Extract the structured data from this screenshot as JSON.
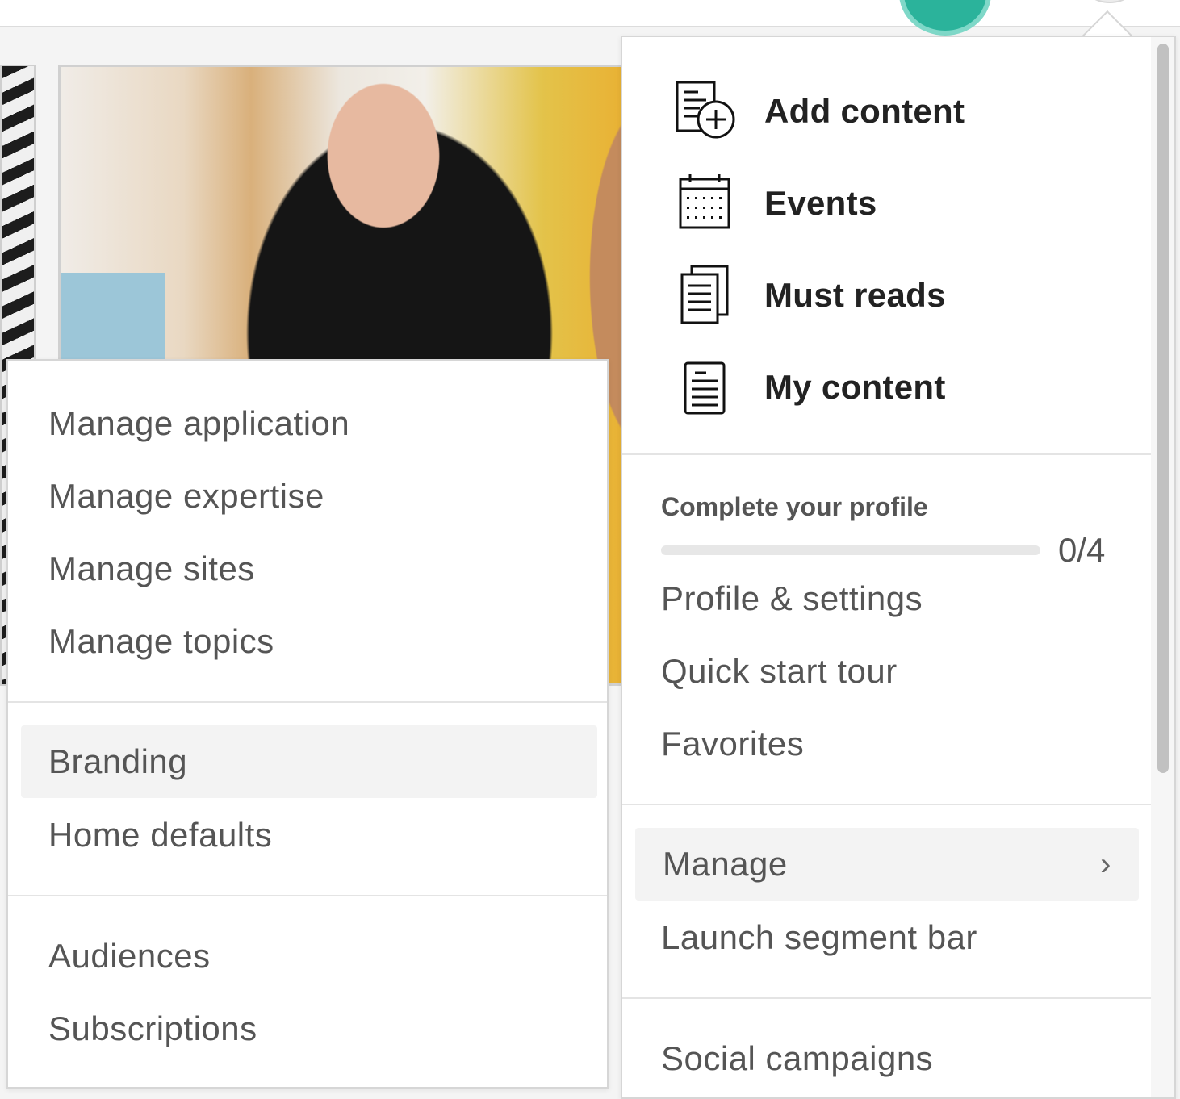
{
  "quick_actions": [
    {
      "label": "Add content",
      "icon": "add-document-icon"
    },
    {
      "label": "Events",
      "icon": "calendar-icon"
    },
    {
      "label": "Must reads",
      "icon": "stacked-documents-icon"
    },
    {
      "label": "My content",
      "icon": "document-icon"
    }
  ],
  "profile": {
    "title": "Complete your profile",
    "progress_text": "0/4",
    "progress_value": 0
  },
  "account_menu": [
    {
      "label": "Profile & settings"
    },
    {
      "label": "Quick start tour"
    },
    {
      "label": "Favorites"
    }
  ],
  "manage_group": [
    {
      "label": "Manage",
      "chevron": "›"
    },
    {
      "label": "Launch segment bar"
    }
  ],
  "extra_group": [
    {
      "label": "Social campaigns"
    }
  ],
  "submenu": {
    "group1": [
      {
        "label": "Manage application"
      },
      {
        "label": "Manage expertise"
      },
      {
        "label": "Manage sites"
      },
      {
        "label": "Manage topics"
      }
    ],
    "group2": [
      {
        "label": "Branding"
      },
      {
        "label": "Home defaults"
      }
    ],
    "group3": [
      {
        "label": "Audiences"
      },
      {
        "label": "Subscriptions"
      }
    ]
  },
  "colors": {
    "accent": "#2bb39b",
    "highlight_bg": "#f3f3f3",
    "text": "#555555"
  }
}
